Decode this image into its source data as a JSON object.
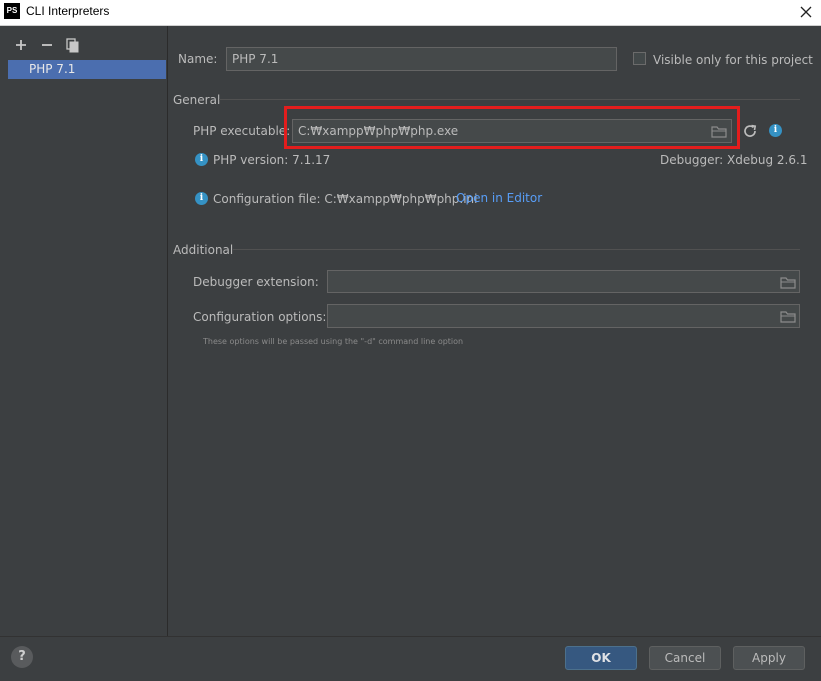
{
  "window": {
    "title": "CLI Interpreters",
    "logo_text": "PS",
    "close_icon": "close-icon"
  },
  "sidebar": {
    "toolbar": [
      {
        "name": "add-icon"
      },
      {
        "name": "remove-icon"
      },
      {
        "name": "copy-icon"
      }
    ],
    "items": [
      {
        "label": "PHP 7.1",
        "selected": true
      }
    ]
  },
  "main": {
    "name_label": "Name:",
    "name_value": "PHP 7.1",
    "visible_only_label": "Visible only for this project",
    "visible_only_checked": false,
    "general": {
      "header": "General",
      "php_exec_label": "PHP executable:",
      "php_exec_value": "C:₩xampp₩php₩php.exe",
      "php_version": "PHP version: 7.1.17",
      "debugger": "Debugger: Xdebug 2.6.1",
      "config_file": "Configuration file: C:₩xampp₩php₩php.ini",
      "open_in_editor": "Open in Editor"
    },
    "additional": {
      "header": "Additional",
      "debugger_ext_label": "Debugger extension:",
      "debugger_ext_value": "",
      "config_options_label": "Configuration options:",
      "config_options_value": "",
      "hint": "These options will be passed using the \"-d\" command line option"
    }
  },
  "footer": {
    "help": "?",
    "ok": "OK",
    "cancel": "Cancel",
    "apply": "Apply"
  },
  "colors": {
    "background": "#3c3f41",
    "selection": "#4b6eaf",
    "highlight": "#e31d1d",
    "link": "#589df6",
    "info": "#3592c4"
  }
}
